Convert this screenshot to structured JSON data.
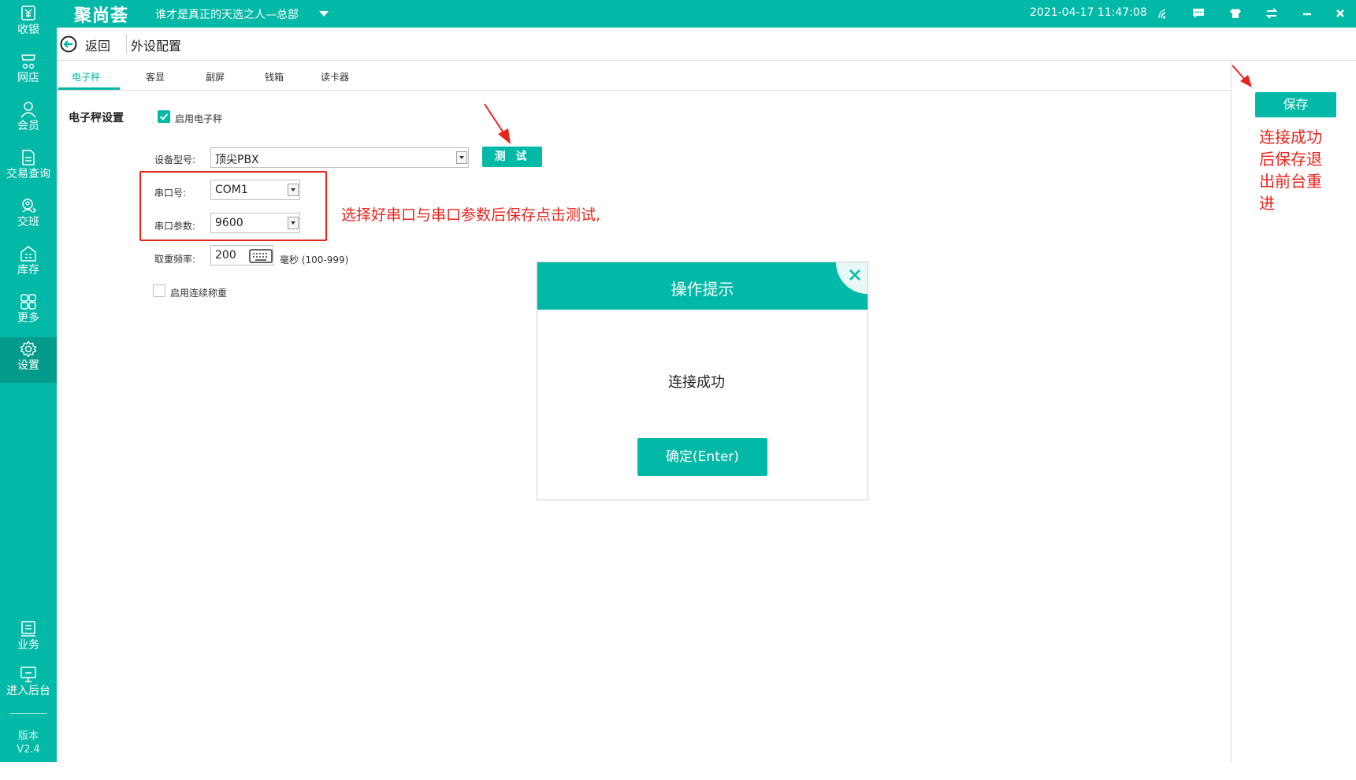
{
  "app": {
    "brand": "聚尚荟",
    "store": "谁才是真正的天选之人—总部",
    "datetime": "2021-04-17 11:47:08"
  },
  "topbar_icons": [
    "wifi-signal-icon",
    "message-icon",
    "shirt-icon",
    "switch-icon",
    "minimize-icon",
    "close-icon"
  ],
  "sidebar": {
    "items": [
      {
        "label": "收银",
        "icon": "cashier-icon"
      },
      {
        "label": "网店",
        "icon": "online-store-icon"
      },
      {
        "label": "会员",
        "icon": "member-icon"
      },
      {
        "label": "交易查询",
        "icon": "transaction-icon"
      },
      {
        "label": "交班",
        "icon": "shift-icon"
      },
      {
        "label": "库存",
        "icon": "inventory-icon"
      },
      {
        "label": "更多",
        "icon": "more-grid-icon"
      },
      {
        "label": "设置",
        "icon": "settings-gear-icon",
        "active": true
      }
    ],
    "bottom_items": [
      {
        "label": "业务",
        "icon": "business-icon"
      },
      {
        "label": "进入后台",
        "icon": "backend-monitor-icon"
      }
    ],
    "version_label": "版本",
    "version_value": "V2.4"
  },
  "header": {
    "back_label": "返回",
    "page_title": "外设配置"
  },
  "tabs": [
    {
      "label": "电子秤",
      "active": true
    },
    {
      "label": "客显"
    },
    {
      "label": "副屏"
    },
    {
      "label": "钱箱"
    },
    {
      "label": "读卡器"
    }
  ],
  "form": {
    "section_title": "电子秤设置",
    "enable_scale_label": "启用电子秤",
    "enable_scale_checked": true,
    "device_model_label": "设备型号:",
    "device_model_value": "顶尖PBX",
    "test_label": "测 试",
    "port_label": "串口号:",
    "port_value": "COM1",
    "baud_label": "串口参数:",
    "baud_value": "9600",
    "freq_label": "取重频率:",
    "freq_value": "200",
    "freq_hint": "毫秒 (100-999)",
    "continuous_label": "启用连续称重",
    "continuous_checked": false
  },
  "save_label": "保存",
  "annotations": {
    "instruction": "选择好串口与串口参数后保存点击测试,",
    "after_save": "连接成功后保存退出前台重进",
    "color": "#e8241e"
  },
  "modal": {
    "title": "操作提示",
    "message": "连接成功",
    "confirm_label": "确定(Enter)"
  },
  "colors": {
    "primary": "#02b8a6",
    "primary_dark": "#029a8b",
    "annotation_red": "#e8241e"
  }
}
